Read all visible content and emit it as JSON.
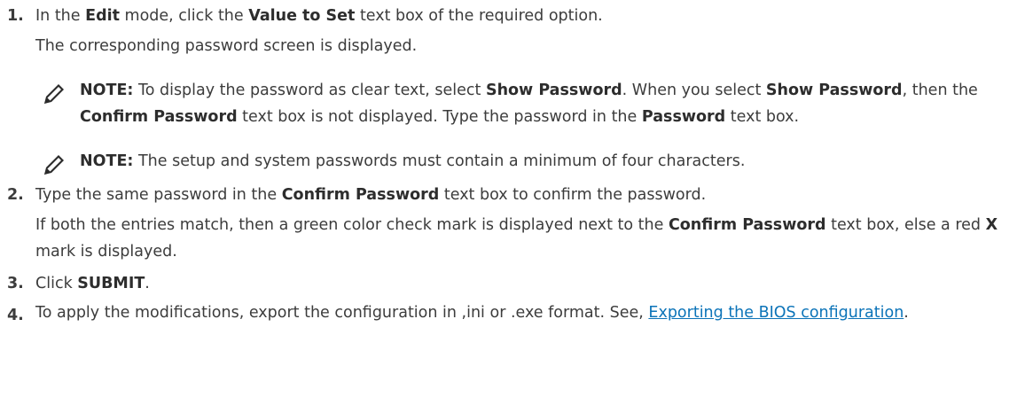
{
  "steps": [
    {
      "number": "1.",
      "seg": [
        "In the ",
        "Edit",
        " mode, click the ",
        "Value to Set",
        " text box of the required option."
      ],
      "result": "The corresponding password screen is displayed.",
      "notes": [
        {
          "label": "NOTE:",
          "seg": [
            " To display the password as clear text, select ",
            "Show Password",
            ". When you select ",
            "Show Password",
            ", then the ",
            "Confirm Password",
            " text box is not displayed. Type the password in the ",
            "Password",
            " text box."
          ]
        },
        {
          "label": "NOTE:",
          "seg": [
            " The setup and system passwords must contain a minimum of four characters."
          ]
        }
      ]
    },
    {
      "number": "2.",
      "seg": [
        "Type the same password in the ",
        "Confirm Password",
        " text box to confirm the password."
      ],
      "result_seg": [
        "If both the entries match, then a green color check mark is displayed next to the ",
        "Confirm Password",
        " text box, else a red ",
        "X",
        " mark is displayed."
      ]
    },
    {
      "number": "3.",
      "seg": [
        "Click ",
        "SUBMIT",
        "."
      ]
    },
    {
      "number": "4.",
      "seg": [
        "To apply the modifications, export the configuration in ,ini or .exe format. See, "
      ],
      "link": "Exporting the BIOS configuration",
      "tail": "."
    }
  ]
}
